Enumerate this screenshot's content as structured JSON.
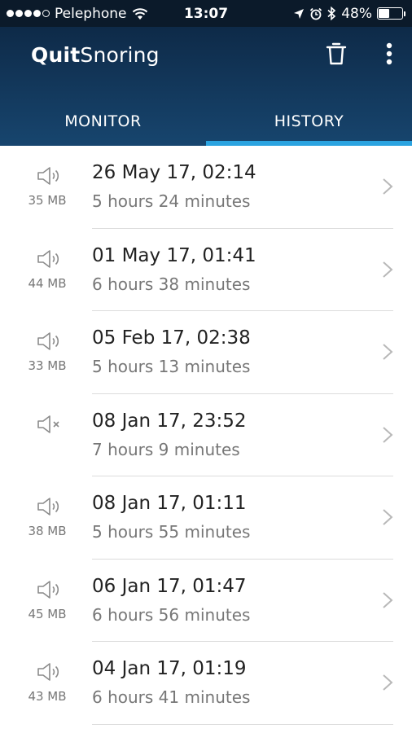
{
  "status_bar": {
    "carrier": "Pelephone",
    "time": "13:07",
    "battery": "48%",
    "battery_level": 0.48,
    "signal_dots_filled": 4,
    "signal_dots_total": 5
  },
  "header": {
    "title_bold": "Quit",
    "title_regular": "Snoring",
    "trash_icon": "trash-icon",
    "more_icon": "more-vertical-icon"
  },
  "tabs": [
    {
      "label": "MONITOR",
      "active": false
    },
    {
      "label": "HISTORY",
      "active": true
    }
  ],
  "colors": {
    "header_top": "#0e2a48",
    "header_bottom": "#17456e",
    "tab_indicator": "#2aa3e0"
  },
  "recordings": [
    {
      "date": "26 May 17, 02:14",
      "duration": "5 hours 24 minutes",
      "size": "35 MB",
      "icon": "speaker-icon"
    },
    {
      "date": "01 May 17, 01:41",
      "duration": "6 hours 38 minutes",
      "size": "44 MB",
      "icon": "speaker-icon"
    },
    {
      "date": "05 Feb 17, 02:38",
      "duration": "5 hours 13 minutes",
      "size": "33 MB",
      "icon": "speaker-icon"
    },
    {
      "date": "08 Jan 17, 23:52",
      "duration": "7 hours 9 minutes",
      "size": "",
      "icon": "speaker-muted-icon"
    },
    {
      "date": "08 Jan 17, 01:11",
      "duration": "5 hours 55 minutes",
      "size": "38 MB",
      "icon": "speaker-icon"
    },
    {
      "date": "06 Jan 17, 01:47",
      "duration": "6 hours 56 minutes",
      "size": "45 MB",
      "icon": "speaker-icon"
    },
    {
      "date": "04 Jan 17, 01:19",
      "duration": "6 hours 41 minutes",
      "size": "43 MB",
      "icon": "speaker-icon"
    }
  ]
}
